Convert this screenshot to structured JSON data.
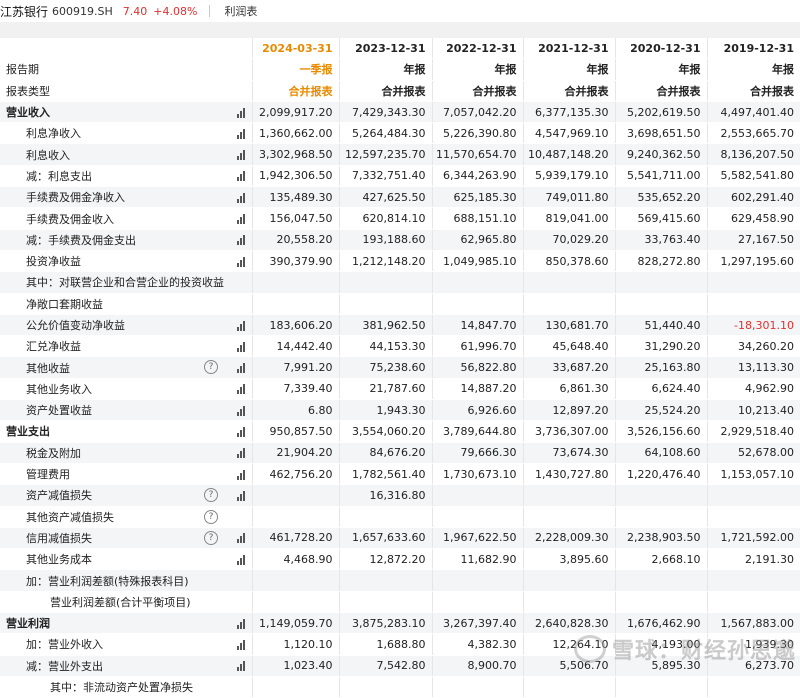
{
  "header": {
    "bank": "江苏银行",
    "code": "600919.SH",
    "price": "7.40",
    "change": "+4.08%",
    "tab": "利润表"
  },
  "columns": {
    "label_col": [
      "报告期",
      "报表类型"
    ],
    "periods": [
      {
        "date": "2024-03-31",
        "period_type": "一季报",
        "report_type": "合并报表"
      },
      {
        "date": "2023-12-31",
        "period_type": "年报",
        "report_type": "合并报表"
      },
      {
        "date": "2022-12-31",
        "period_type": "年报",
        "report_type": "合并报表"
      },
      {
        "date": "2021-12-31",
        "period_type": "年报",
        "report_type": "合并报表"
      },
      {
        "date": "2020-12-31",
        "period_type": "年报",
        "report_type": "合并报表"
      },
      {
        "date": "2019-12-31",
        "period_type": "年报",
        "report_type": "合并报表"
      }
    ]
  },
  "rows": [
    {
      "label": "营业收入",
      "bold": true,
      "indent": 0,
      "caret": true,
      "icon": "bars",
      "values": [
        "2,099,917.20",
        "7,429,343.30",
        "7,057,042.20",
        "6,377,135.30",
        "5,202,619.50",
        "4,497,401.40"
      ]
    },
    {
      "label": "利息净收入",
      "indent": 1,
      "icon": "bars",
      "values": [
        "1,360,662.00",
        "5,264,484.30",
        "5,226,390.80",
        "4,547,969.10",
        "3,698,651.50",
        "2,553,665.70"
      ]
    },
    {
      "label": "利息收入",
      "indent": 1,
      "icon": "bars",
      "values": [
        "3,302,968.50",
        "12,597,235.70",
        "11,570,654.70",
        "10,487,148.20",
        "9,240,362.50",
        "8,136,207.50"
      ]
    },
    {
      "label": "减：利息支出",
      "indent": 1,
      "icon": "bars",
      "values": [
        "1,942,306.50",
        "7,332,751.40",
        "6,344,263.90",
        "5,939,179.10",
        "5,541,711.00",
        "5,582,541.80"
      ]
    },
    {
      "label": "手续费及佣金净收入",
      "indent": 1,
      "icon": "bars",
      "values": [
        "135,489.30",
        "427,625.50",
        "625,185.30",
        "749,011.80",
        "535,652.20",
        "602,291.40"
      ]
    },
    {
      "label": "手续费及佣金收入",
      "indent": 1,
      "icon": "bars",
      "values": [
        "156,047.50",
        "620,814.10",
        "688,151.10",
        "819,041.00",
        "569,415.60",
        "629,458.90"
      ]
    },
    {
      "label": "减：手续费及佣金支出",
      "indent": 1,
      "icon": "bars",
      "values": [
        "20,558.20",
        "193,188.60",
        "62,965.80",
        "70,029.20",
        "33,763.40",
        "27,167.50"
      ]
    },
    {
      "label": "投资净收益",
      "indent": 1,
      "icon": "bars",
      "values": [
        "390,379.90",
        "1,212,148.20",
        "1,049,985.10",
        "850,378.60",
        "828,272.80",
        "1,297,195.60"
      ]
    },
    {
      "label": "其中：对联营企业和合营企业的投资收益",
      "indent": 1,
      "icon": "",
      "values": [
        "",
        "",
        "",
        "",
        "",
        ""
      ]
    },
    {
      "label": "净敞口套期收益",
      "indent": 1,
      "icon": "",
      "values": [
        "",
        "",
        "",
        "",
        "",
        ""
      ]
    },
    {
      "label": "公允价值变动净收益",
      "indent": 1,
      "icon": "bars",
      "values": [
        "183,606.20",
        "381,962.50",
        "14,847.70",
        "130,681.70",
        "51,440.40",
        "-18,301.10"
      ],
      "neg_index": 5
    },
    {
      "label": "汇兑净收益",
      "indent": 1,
      "icon": "bars",
      "values": [
        "14,442.40",
        "44,153.30",
        "61,996.70",
        "45,648.40",
        "31,290.20",
        "34,260.20"
      ]
    },
    {
      "label": "其他收益",
      "indent": 1,
      "icon": "qm-bars",
      "values": [
        "7,991.20",
        "75,238.60",
        "56,822.80",
        "33,687.20",
        "25,163.80",
        "13,113.30"
      ]
    },
    {
      "label": "其他业务收入",
      "indent": 1,
      "icon": "bars",
      "values": [
        "7,339.40",
        "21,787.60",
        "14,887.20",
        "6,861.30",
        "6,624.40",
        "4,962.90"
      ]
    },
    {
      "label": "资产处置收益",
      "indent": 1,
      "icon": "bars",
      "values": [
        "6.80",
        "1,943.30",
        "6,926.60",
        "12,897.20",
        "25,524.20",
        "10,213.40"
      ]
    },
    {
      "label": "营业支出",
      "bold": true,
      "indent": 0,
      "icon": "bars",
      "values": [
        "950,857.50",
        "3,554,060.20",
        "3,789,644.80",
        "3,736,307.00",
        "3,526,156.60",
        "2,929,518.40"
      ]
    },
    {
      "label": "税金及附加",
      "indent": 1,
      "icon": "bars",
      "values": [
        "21,904.20",
        "84,676.20",
        "79,666.30",
        "73,674.30",
        "64,108.60",
        "52,678.00"
      ]
    },
    {
      "label": "管理费用",
      "indent": 1,
      "icon": "bars",
      "values": [
        "462,756.20",
        "1,782,561.40",
        "1,730,673.10",
        "1,430,727.80",
        "1,220,476.40",
        "1,153,057.10"
      ]
    },
    {
      "label": "资产减值损失",
      "indent": 1,
      "icon": "qm-bars",
      "values": [
        "",
        "16,316.80",
        "",
        "",
        "",
        ""
      ]
    },
    {
      "label": "其他资产减值损失",
      "indent": 1,
      "icon": "qm",
      "values": [
        "",
        "",
        "",
        "",
        "",
        ""
      ]
    },
    {
      "label": "信用减值损失",
      "indent": 1,
      "icon": "qm-bars",
      "values": [
        "461,728.20",
        "1,657,633.60",
        "1,967,622.50",
        "2,228,009.30",
        "2,238,903.50",
        "1,721,592.00"
      ]
    },
    {
      "label": "其他业务成本",
      "indent": 1,
      "icon": "bars",
      "values": [
        "4,468.90",
        "12,872.20",
        "11,682.90",
        "3,895.60",
        "2,668.10",
        "2,191.30"
      ]
    },
    {
      "label": "加：营业利润差额(特殊报表科目)",
      "indent": 1,
      "icon": "",
      "values": [
        "",
        "",
        "",
        "",
        "",
        ""
      ]
    },
    {
      "label": "营业利润差额(合计平衡项目)",
      "indent": 2,
      "icon": "",
      "values": [
        "",
        "",
        "",
        "",
        "",
        ""
      ]
    },
    {
      "label": "营业利润",
      "bold": true,
      "indent": 0,
      "icon": "bars",
      "values": [
        "1,149,059.70",
        "3,875,283.10",
        "3,267,397.40",
        "2,640,828.30",
        "1,676,462.90",
        "1,567,883.00"
      ]
    },
    {
      "label": "加：营业外收入",
      "indent": 1,
      "icon": "bars",
      "values": [
        "1,120.10",
        "1,688.80",
        "4,382.30",
        "12,264.10",
        "4,193.00",
        "1,939.30"
      ]
    },
    {
      "label": "减：营业外支出",
      "indent": 1,
      "icon": "bars",
      "values": [
        "1,023.40",
        "7,542.80",
        "8,900.70",
        "5,506.70",
        "5,895.30",
        "6,273.70"
      ]
    },
    {
      "label": "其中：非流动资产处置净损失",
      "indent": 2,
      "icon": "",
      "values": [
        "",
        "",
        "",
        "",
        "",
        ""
      ]
    }
  ],
  "watermark": "雪球：财经孙思邈"
}
